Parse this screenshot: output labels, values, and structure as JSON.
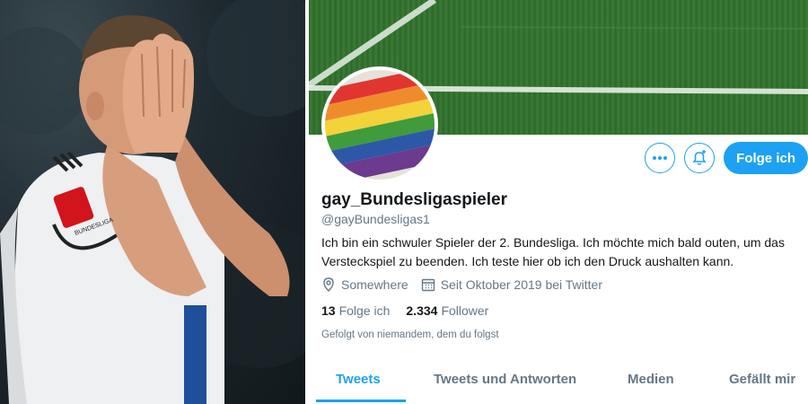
{
  "photo": {
    "description_icon": "footballer-face-in-hands-photo",
    "badge_text": "BUNDESLIGA"
  },
  "profile": {
    "display_name": "gay_Bundesligaspieler",
    "handle": "@gayBundesligas1",
    "bio_line1": "Ich bin ein schwuler Spieler der 2. Bundesliga. Ich möchte mich bald outen, um das",
    "bio_line2": "Versteckspiel zu beenden. Ich teste hier ob ich den Druck aushalten kann.",
    "location": "Somewhere",
    "joined": "Seit Oktober 2019 bei Twitter",
    "following_count": "13",
    "following_label": "Folge ich",
    "followers_count": "2.334",
    "followers_label": "Follower",
    "followed_by": "Gefolgt von niemandem, dem du folgst"
  },
  "actions": {
    "more_icon": "more-dots-icon",
    "notify_icon": "bell-plus-icon",
    "follow_label": "Folge ich"
  },
  "tabs": [
    {
      "label": "Tweets",
      "active": true
    },
    {
      "label": "Tweets und Antworten",
      "active": false
    },
    {
      "label": "Medien",
      "active": false
    },
    {
      "label": "Gefällt mir",
      "active": false
    }
  ],
  "colors": {
    "accent": "#1da1f2",
    "text": "#14171a",
    "muted": "#657786"
  }
}
